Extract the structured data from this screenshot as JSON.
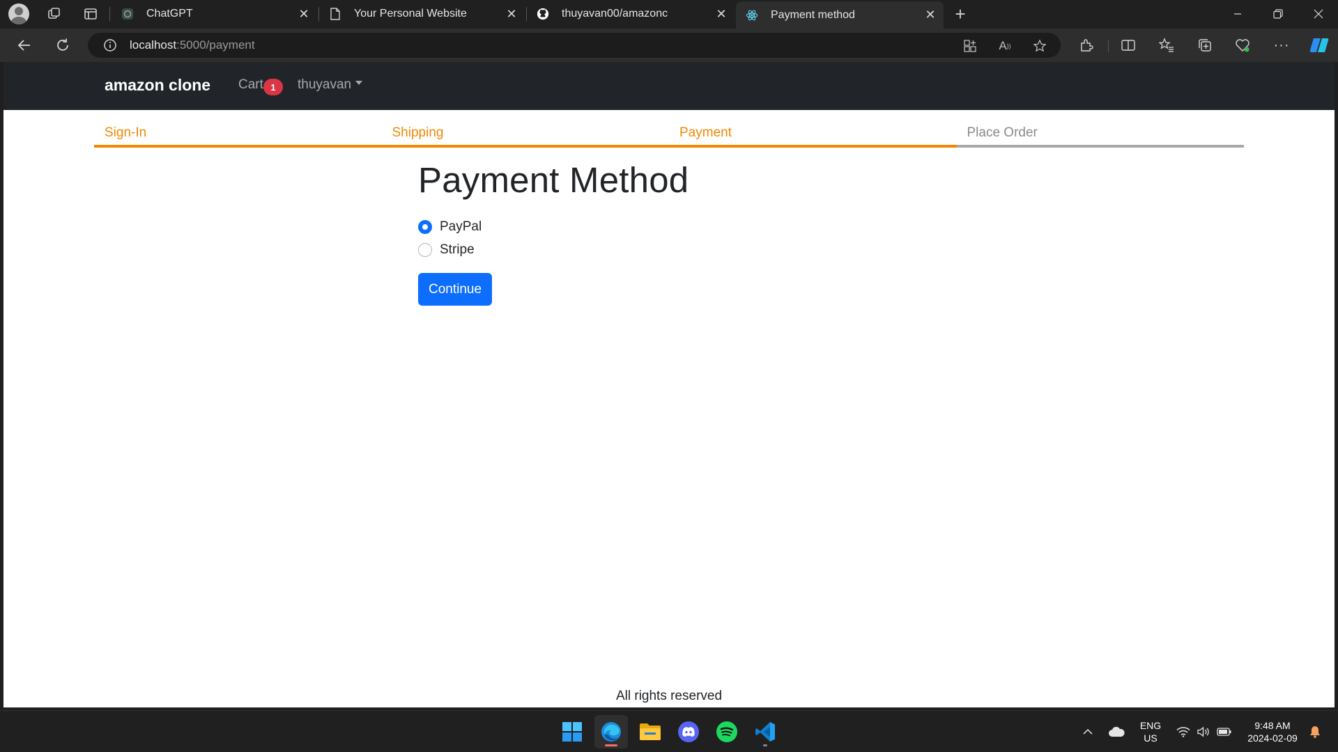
{
  "browser": {
    "tabs": [
      {
        "title": "ChatGPT",
        "icon": "chatgpt-icon",
        "active": false
      },
      {
        "title": "Your Personal Website",
        "icon": "document-icon",
        "active": false
      },
      {
        "title": "thuyavan00/amazonc",
        "icon": "github-icon",
        "active": false
      },
      {
        "title": "Payment method",
        "icon": "react-icon",
        "active": true
      }
    ],
    "address": {
      "host": "localhost",
      "path": ":5000/payment"
    }
  },
  "site": {
    "brand": "amazon clone",
    "cart_label": "Cart",
    "cart_count": "1",
    "user_name": "thuyavan"
  },
  "checkout_steps": [
    {
      "label": "Sign-In",
      "active": true
    },
    {
      "label": "Shipping",
      "active": true
    },
    {
      "label": "Payment",
      "active": true
    },
    {
      "label": "Place Order",
      "active": false
    }
  ],
  "payment": {
    "title": "Payment Method",
    "options": [
      {
        "label": "PayPal",
        "checked": true
      },
      {
        "label": "Stripe",
        "checked": false
      }
    ],
    "continue_label": "Continue"
  },
  "footer": {
    "text": "All rights reserved"
  },
  "taskbar": {
    "apps": [
      "windows-start-icon",
      "edge-icon",
      "file-explorer-icon",
      "discord-icon",
      "spotify-icon",
      "vscode-icon"
    ],
    "language": "ENG",
    "region": "US",
    "time": "9:48 AM",
    "date": "2024-02-09"
  },
  "colors": {
    "accent_orange": "#f08804",
    "primary_blue": "#0d6efd",
    "navbar_dark": "#212529",
    "badge_red": "#dc3545"
  }
}
